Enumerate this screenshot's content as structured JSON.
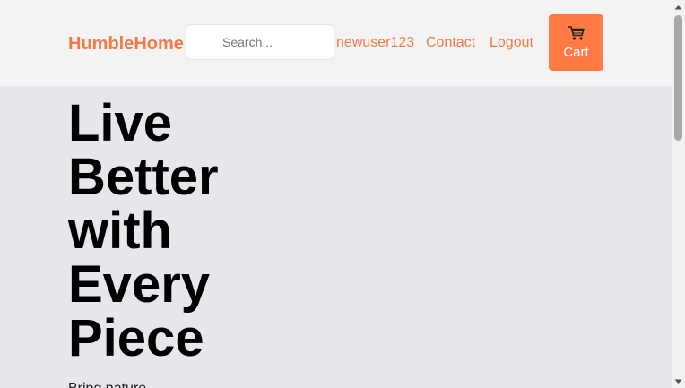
{
  "header": {
    "logo": "HumbleHome",
    "search": {
      "placeholder": "Search...",
      "value": ""
    },
    "nav": {
      "user": "newuser123",
      "contact": "Contact",
      "logout": "Logout"
    },
    "cart": {
      "label": "Cart",
      "icon": "cart-icon"
    }
  },
  "hero": {
    "title_lines": [
      "Live",
      "Better",
      "with",
      "Every",
      "Piece"
    ],
    "subtitle": "Bring nature..."
  },
  "colors": {
    "accent": "#f47a45",
    "cart_bg": "#ff7a45",
    "header_bg": "#f3f3f3",
    "page_bg": "#e5e7eb"
  }
}
